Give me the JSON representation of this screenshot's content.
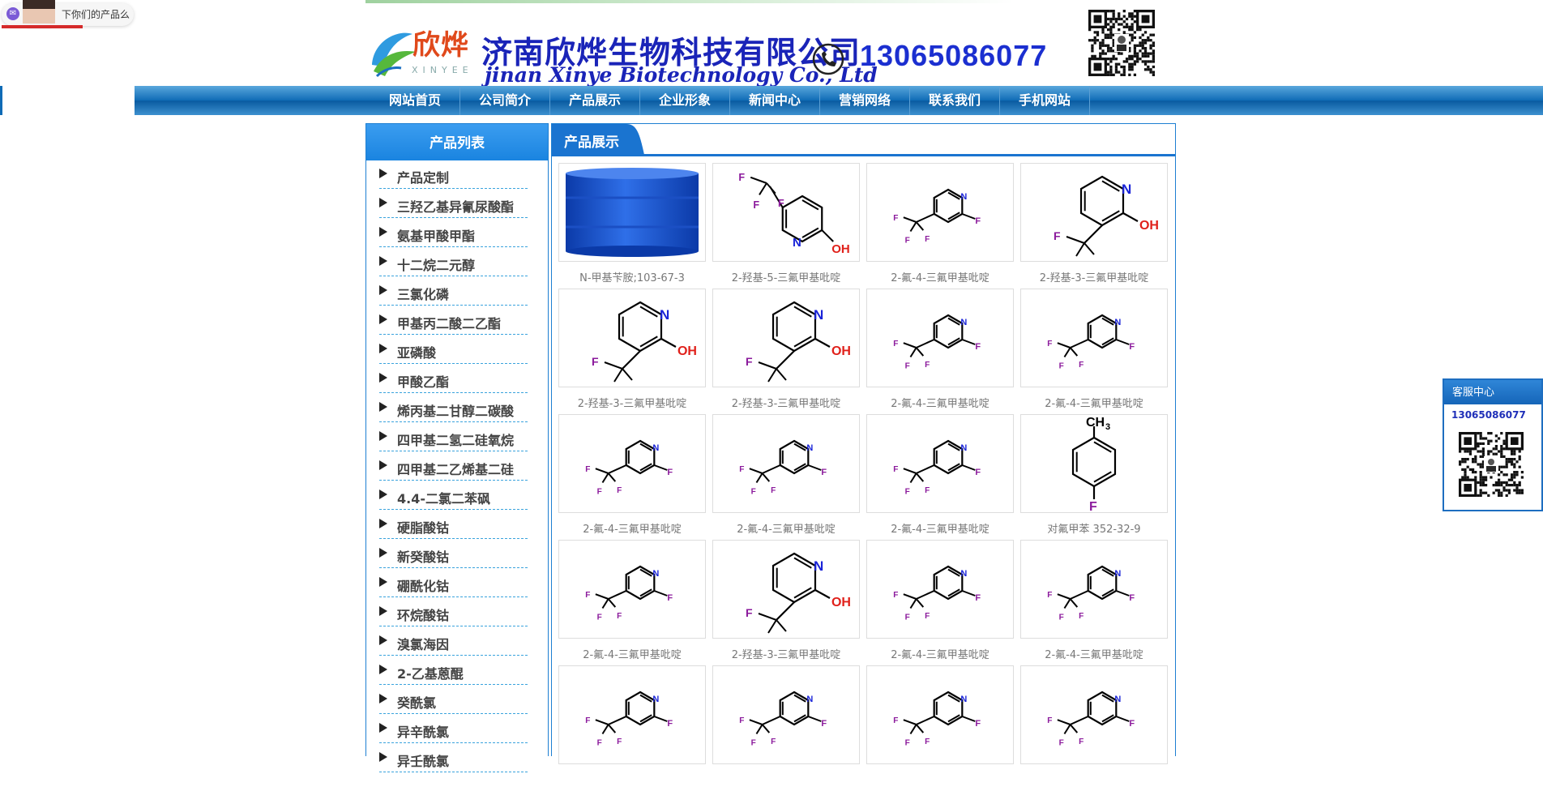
{
  "chat_widget": {
    "text": "下你们的产品么"
  },
  "header": {
    "logo_cn": "欣烨",
    "logo_en": "XINYEE",
    "company_cn": "济南欣烨生物科技有限公司",
    "company_en": "jinan Xinye Biotechnology Co., Ltd",
    "phone": "13065086077"
  },
  "nav": [
    {
      "label": "网站首页"
    },
    {
      "label": "公司简介"
    },
    {
      "label": "产品展示"
    },
    {
      "label": "企业形象"
    },
    {
      "label": "新闻中心"
    },
    {
      "label": "营销网络"
    },
    {
      "label": "联系我们"
    },
    {
      "label": "手机网站"
    }
  ],
  "sidebar": {
    "title": "产品列表",
    "items": [
      {
        "label": "产品定制"
      },
      {
        "label": "三羟乙基异氰尿酸酯"
      },
      {
        "label": "氨基甲酸甲酯"
      },
      {
        "label": "十二烷二元醇"
      },
      {
        "label": "三氯化磷"
      },
      {
        "label": "甲基丙二酸二乙酯"
      },
      {
        "label": "亚磷酸"
      },
      {
        "label": "甲酸乙酯"
      },
      {
        "label": "烯丙基二甘醇二碳酸"
      },
      {
        "label": "四甲基二氢二硅氧烷"
      },
      {
        "label": "四甲基二乙烯基二硅"
      },
      {
        "label": "4.4-二氯二苯砜"
      },
      {
        "label": "硬脂酸钴"
      },
      {
        "label": "新癸酸钴"
      },
      {
        "label": "硼酰化钴"
      },
      {
        "label": "环烷酸钴"
      },
      {
        "label": "溴氯海因"
      },
      {
        "label": "2-乙基蒽醌"
      },
      {
        "label": "癸酰氯"
      },
      {
        "label": "异辛酰氯"
      },
      {
        "label": "异壬酰氯"
      }
    ]
  },
  "main": {
    "title": "产品展示",
    "products": [
      {
        "caption": "N-甲基苄胺;103-67-3",
        "image": "blue-drum"
      },
      {
        "caption": "2-羟基-5-三氟甲基吡啶",
        "image": "hydroxy-5-cf3"
      },
      {
        "caption": "2-氟-4-三氟甲基吡啶",
        "image": "fluoro-4-cf3"
      },
      {
        "caption": "2-羟基-3-三氟甲基吡啶",
        "image": "hydroxy-3-cf3"
      },
      {
        "caption": "2-羟基-3-三氟甲基吡啶",
        "image": "hydroxy-3-cf3"
      },
      {
        "caption": "2-羟基-3-三氟甲基吡啶",
        "image": "hydroxy-3-cf3"
      },
      {
        "caption": "2-氟-4-三氟甲基吡啶",
        "image": "fluoro-4-cf3"
      },
      {
        "caption": "2-氟-4-三氟甲基吡啶",
        "image": "fluoro-4-cf3"
      },
      {
        "caption": "2-氟-4-三氟甲基吡啶",
        "image": "fluoro-4-cf3"
      },
      {
        "caption": "2-氟-4-三氟甲基吡啶",
        "image": "fluoro-4-cf3"
      },
      {
        "caption": "2-氟-4-三氟甲基吡啶",
        "image": "fluoro-4-cf3"
      },
      {
        "caption": "对氟甲苯 352-32-9",
        "image": "p-fluorotoluene"
      },
      {
        "caption": "2-氟-4-三氟甲基吡啶",
        "image": "fluoro-4-cf3"
      },
      {
        "caption": "2-羟基-3-三氟甲基吡啶",
        "image": "hydroxy-3-cf3"
      },
      {
        "caption": "2-氟-4-三氟甲基吡啶",
        "image": "fluoro-4-cf3"
      },
      {
        "caption": "2-氟-4-三氟甲基吡啶",
        "image": "fluoro-4-cf3"
      },
      {
        "caption": "",
        "image": "fluoro-4-cf3"
      },
      {
        "caption": "",
        "image": "fluoro-4-cf3"
      },
      {
        "caption": "",
        "image": "fluoro-4-cf3"
      },
      {
        "caption": "",
        "image": "fluoro-4-cf3"
      }
    ]
  },
  "customer_service": {
    "title": "客服中心",
    "phone": "13065086077"
  },
  "colors": {
    "nav_blue": "#0f6bb6",
    "panel_border": "#1e7fd2",
    "atom_fluorine": "#8b1a9c",
    "atom_nitrogen": "#1a24d8",
    "atom_oxygen": "#e0201a",
    "company_blue": "#1a24b8"
  }
}
